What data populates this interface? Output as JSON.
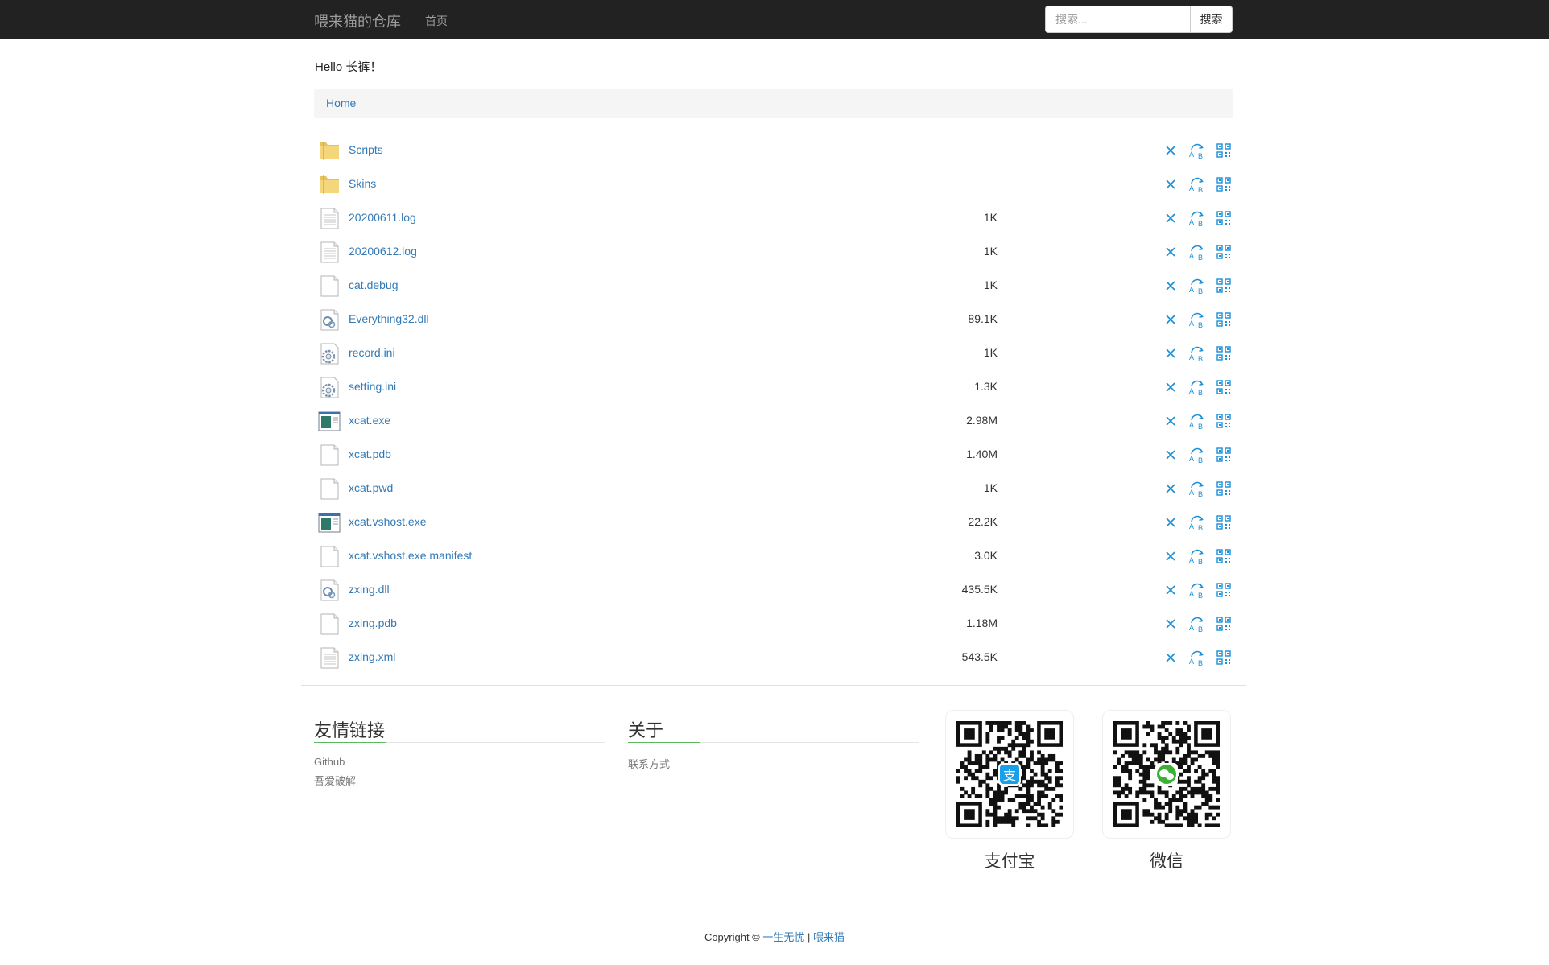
{
  "navbar": {
    "brand": "喂来猫的仓库",
    "home_link": "首页",
    "search_placeholder": "搜索...",
    "search_button": "搜索"
  },
  "greeting": "Hello 长裤！",
  "breadcrumb": {
    "home": "Home"
  },
  "files": [
    {
      "name": "Scripts",
      "size": "",
      "icon": "folder-icon"
    },
    {
      "name": "Skins",
      "size": "",
      "icon": "folder-icon"
    },
    {
      "name": "20200611.log",
      "size": "1K",
      "icon": "text-file-icon"
    },
    {
      "name": "20200612.log",
      "size": "1K",
      "icon": "text-file-icon"
    },
    {
      "name": "cat.debug",
      "size": "1K",
      "icon": "blank-file-icon"
    },
    {
      "name": "Everything32.dll",
      "size": "89.1K",
      "icon": "dll-file-icon"
    },
    {
      "name": "record.ini",
      "size": "1K",
      "icon": "ini-file-icon"
    },
    {
      "name": "setting.ini",
      "size": "1.3K",
      "icon": "ini-file-icon"
    },
    {
      "name": "xcat.exe",
      "size": "2.98M",
      "icon": "exe-file-icon"
    },
    {
      "name": "xcat.pdb",
      "size": "1.40M",
      "icon": "blank-file-icon"
    },
    {
      "name": "xcat.pwd",
      "size": "1K",
      "icon": "blank-file-icon"
    },
    {
      "name": "xcat.vshost.exe",
      "size": "22.2K",
      "icon": "exe-file-icon"
    },
    {
      "name": "xcat.vshost.exe.manifest",
      "size": "3.0K",
      "icon": "blank-file-icon"
    },
    {
      "name": "zxing.dll",
      "size": "435.5K",
      "icon": "dll-file-icon"
    },
    {
      "name": "zxing.pdb",
      "size": "1.18M",
      "icon": "blank-file-icon"
    },
    {
      "name": "zxing.xml",
      "size": "543.5K",
      "icon": "text-file-icon"
    }
  ],
  "footer": {
    "links_title": "友情链接",
    "links": [
      "Github",
      "吾爱破解"
    ],
    "about_title": "关于",
    "about_links": [
      "联系方式"
    ],
    "alipay_label": "支付宝",
    "wechat_label": "微信",
    "copyright_prefix": "Copyright ©",
    "copyright_author": "一生无忧",
    "copyright_sep": "|",
    "copyright_site": "喂来猫"
  },
  "colors": {
    "navbar_bg": "#222222",
    "link": "#337ab7",
    "action_blue": "#1a8fd6",
    "footer_accent": "#5cb85c"
  }
}
